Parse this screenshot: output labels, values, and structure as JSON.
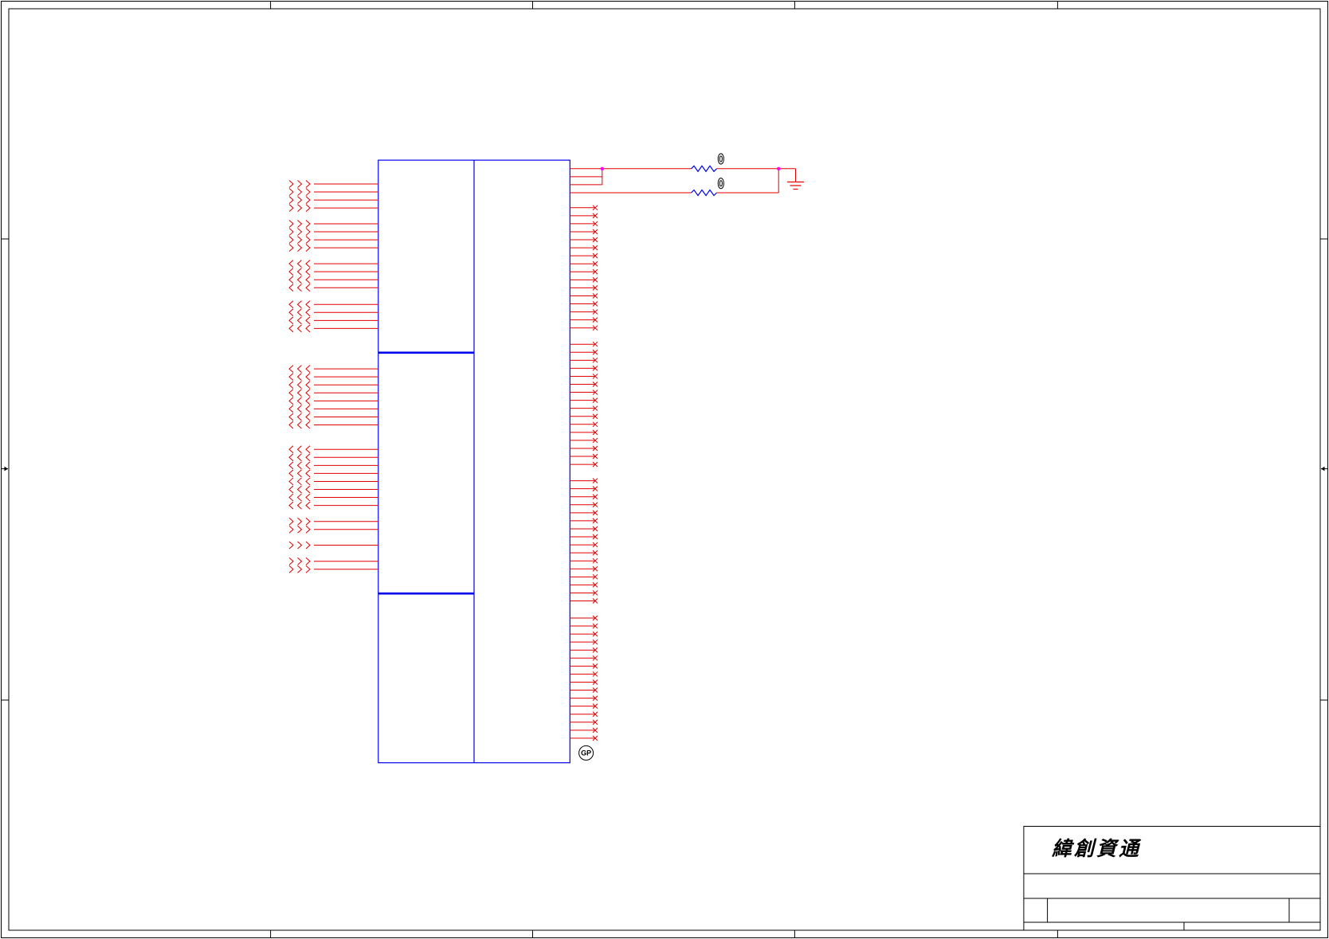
{
  "title_block": {
    "company": "緯創資通"
  },
  "component": {
    "badge": "GP"
  },
  "colors": {
    "wire": "#e00000",
    "body": "#0000ee",
    "junction": "#ff00ff",
    "frame": "#000000",
    "marker": "#000000"
  },
  "symbols": {
    "connector": "offpage-connector-icon",
    "no_connect": "no-connect-icon",
    "resistor": "resistor-icon",
    "ground": "ground-icon",
    "junction": "junction-dot-icon"
  }
}
